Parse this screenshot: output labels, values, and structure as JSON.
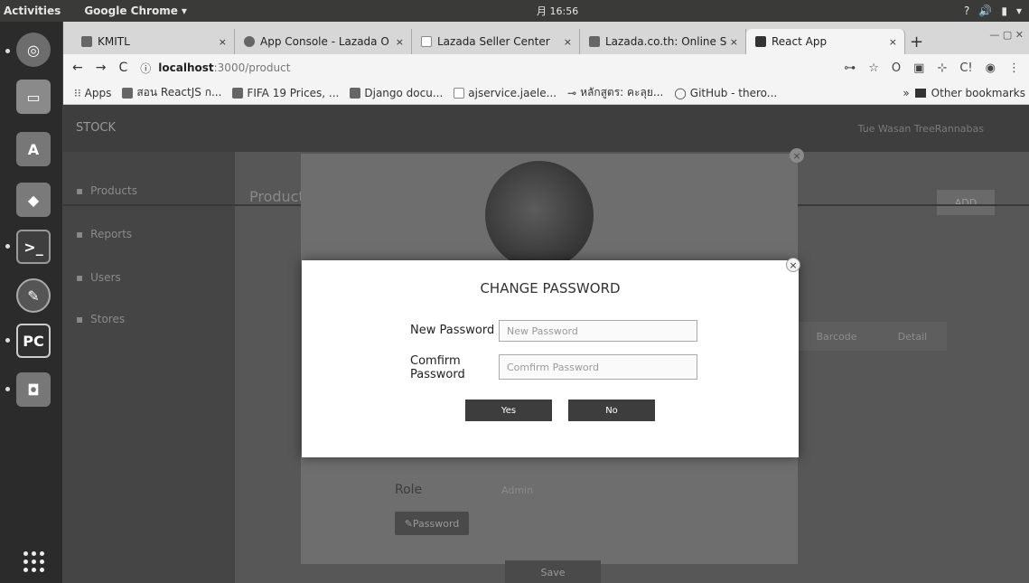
{
  "topbar": {
    "activities": "Activities",
    "app_name": "Google Chrome",
    "app_arrow": "▾",
    "clock": "月 16:56",
    "tray": [
      "?",
      "🔊",
      "▮",
      "▾"
    ]
  },
  "launcher": {
    "icons": [
      {
        "name": "chrome-icon",
        "color": "#6d6d6d",
        "glyph": "◎"
      },
      {
        "name": "files-icon",
        "color": "#8a8a8a",
        "glyph": "▭"
      },
      {
        "name": "software-center-icon",
        "color": "#777777",
        "glyph": "A"
      },
      {
        "name": "git-icon",
        "color": "#7a7a7a",
        "glyph": "◆"
      },
      {
        "name": "terminal-icon",
        "color": "#3e3e3e",
        "glyph": ">_"
      },
      {
        "name": "inkscape-icon",
        "color": "#555555",
        "glyph": "✎"
      },
      {
        "name": "pycharm-icon",
        "color": "#2f2f2f",
        "glyph": "PC"
      },
      {
        "name": "screenshot-icon",
        "color": "#777777",
        "glyph": "◘"
      }
    ]
  },
  "tabs": [
    {
      "label": "KMITL",
      "close": "×"
    },
    {
      "label": "App Console - Lazada O",
      "close": "×"
    },
    {
      "label": "Lazada Seller Center",
      "close": "×"
    },
    {
      "label": "Lazada.co.th: Online S",
      "close": "×"
    },
    {
      "label": "React App",
      "close": "×"
    }
  ],
  "newtab": "+",
  "window_controls": "— ▢ ✕",
  "toolbar": {
    "back": "←",
    "forward": "→",
    "reload": "C",
    "info": "ⓘ",
    "url_host": "localhost",
    "url_path": ":3000/product",
    "right_icons": [
      "⊶",
      "☆",
      "O",
      "▣",
      "⊹",
      "C!",
      "◉",
      "⋮"
    ]
  },
  "bookmarks": {
    "apps": "Apps",
    "items": [
      "สอน ReactJS ก...",
      "FIFA 19 Prices, ...",
      "Django docu...",
      "ajservice.jaele...",
      "หลักสูตร: คะลุย...",
      "GitHub - thero..."
    ],
    "more": "»",
    "other": "Other bookmarks"
  },
  "app": {
    "brand": "STOCK",
    "user": "Tue Wasan TreeRannabas",
    "sidebar": [
      "Products",
      "Reports",
      "Users",
      "Stores"
    ],
    "page_title": "Products",
    "add_label": "ADD",
    "barcode_label": "Barcode",
    "detail_label": "Detail"
  },
  "edit_modal": {
    "role_label": "Role",
    "role_value": "Admin",
    "password_button": "✎Password",
    "save_button": "Save",
    "close": "×"
  },
  "change_password": {
    "title": "CHANGE PASSWORD",
    "new_password_label": "New Password",
    "new_password_placeholder": "New Password",
    "confirm_password_label": "Comfirm Password",
    "confirm_password_placeholder": "Comfirm Password",
    "yes": "Yes",
    "no": "No",
    "close": "×"
  }
}
